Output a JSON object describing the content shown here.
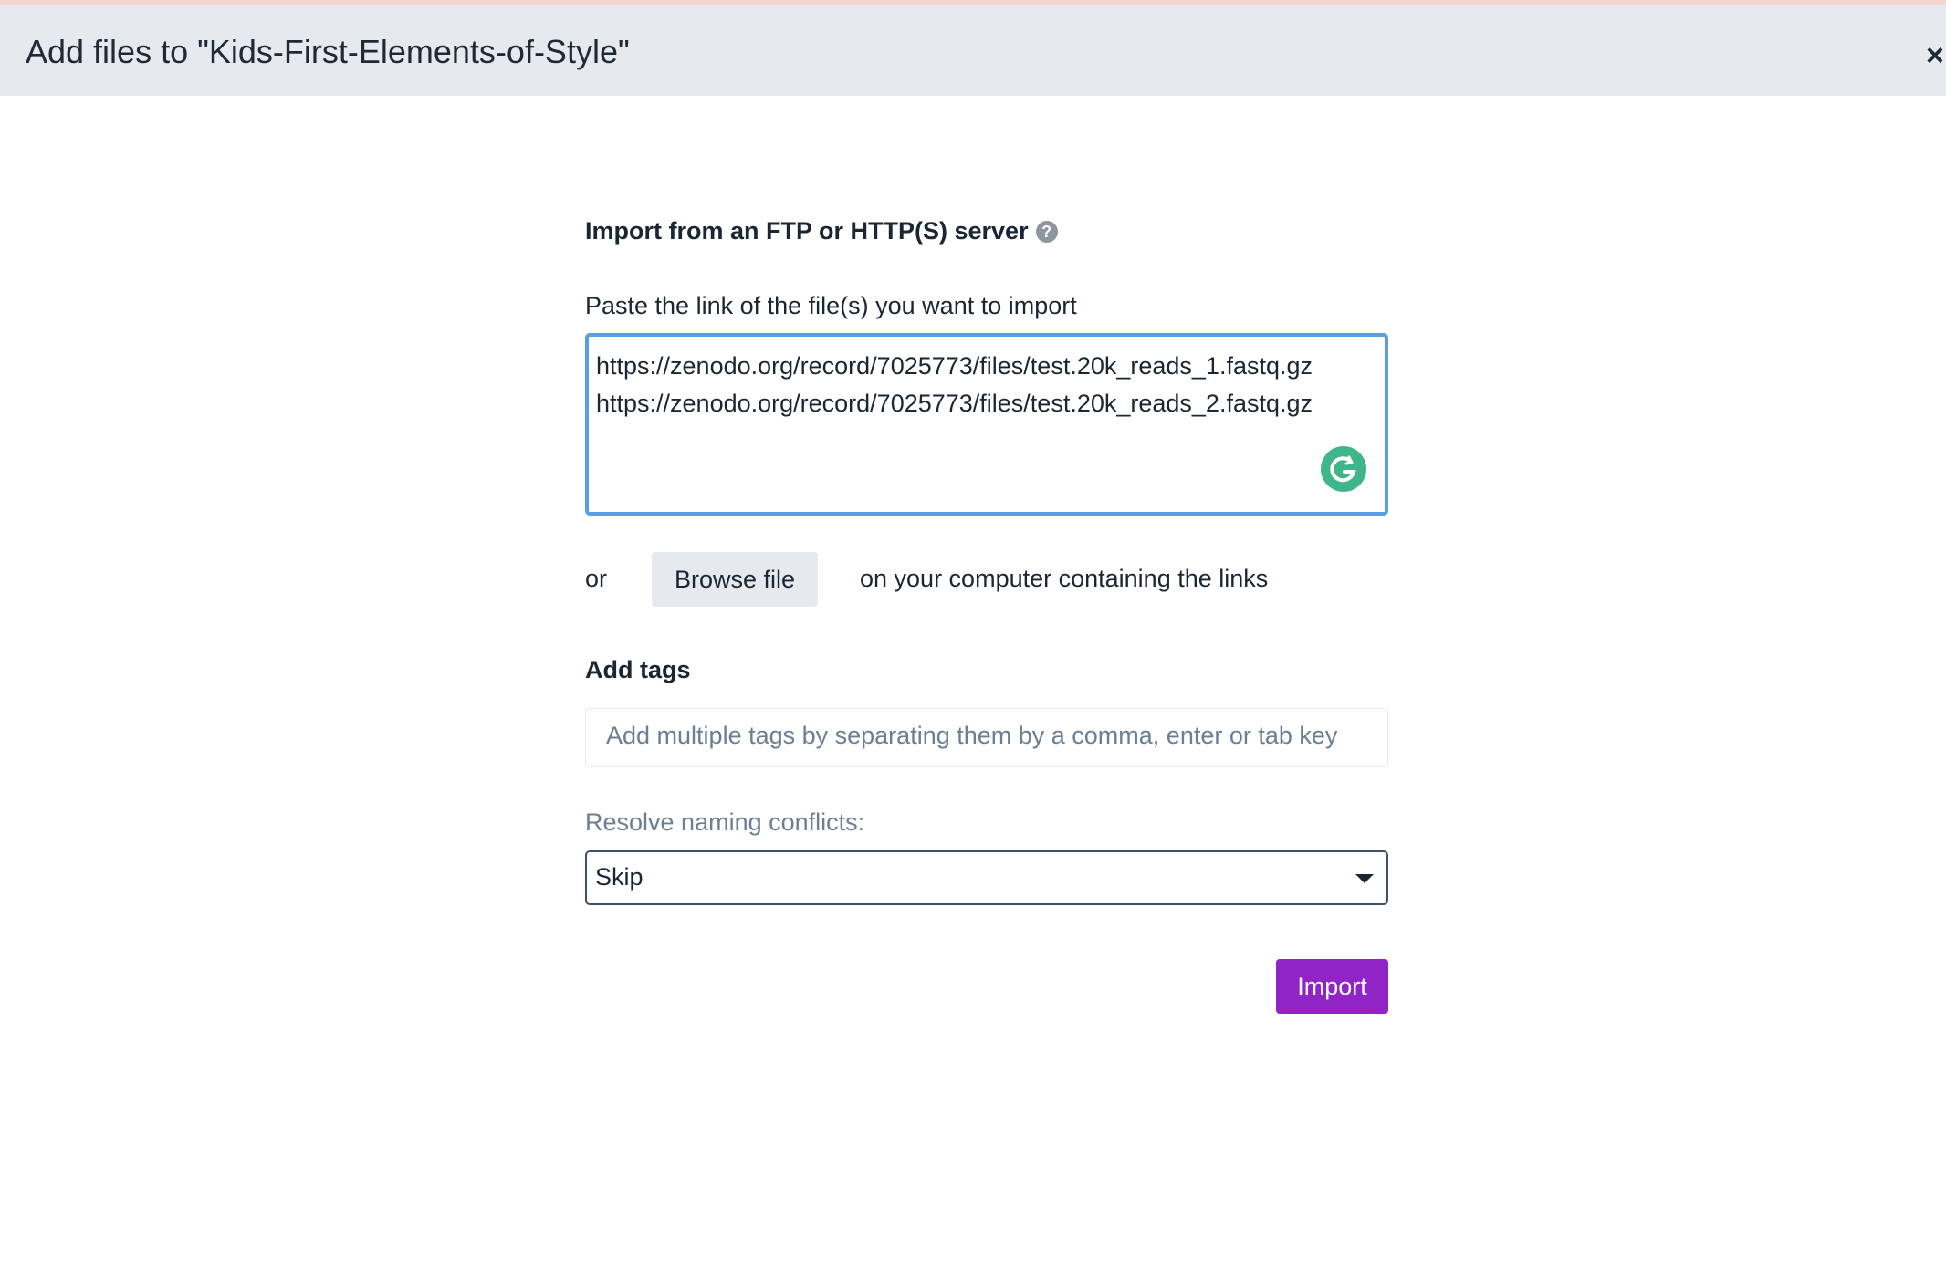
{
  "dialog": {
    "title": "Add files to \"Kids-First-Elements-of-Style\"",
    "close_icon": "×"
  },
  "import_section": {
    "title": "Import from an FTP or HTTP(S) server",
    "help_icon": "?",
    "paste_label": "Paste the link of the file(s) you want to import",
    "links": [
      "https://zenodo.org/record/7025773/files/test.20k_reads_1.fastq.gz",
      "https://zenodo.org/record/7025773/files/test.20k_reads_2.fastq.gz"
    ],
    "or_text": "or",
    "browse_button": "Browse file",
    "or_suffix": "on your computer containing the links"
  },
  "tags": {
    "title": "Add tags",
    "placeholder": "Add multiple tags by separating them by a comma, enter or tab key"
  },
  "naming_conflicts": {
    "label": "Resolve naming conflicts:",
    "selected": "Skip"
  },
  "import_button": "Import",
  "colors": {
    "header_bg": "#e6e9ee",
    "focus_border": "#5a9ee8",
    "import_button_bg": "#9024c7",
    "grammarly_green": "#3fb58a"
  }
}
